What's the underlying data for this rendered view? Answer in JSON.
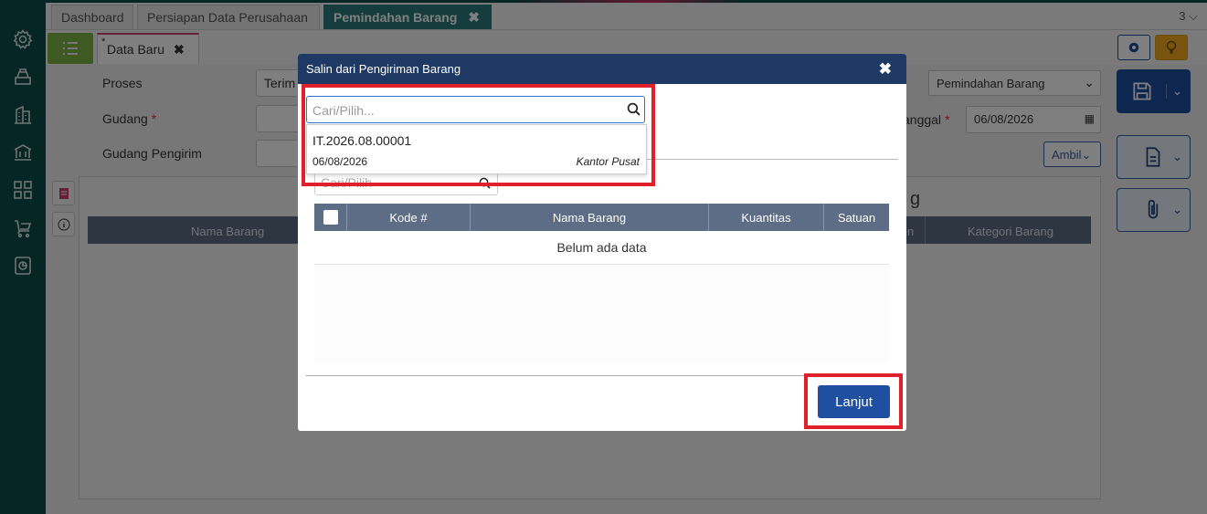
{
  "tabs": [
    {
      "label": "Dashboard"
    },
    {
      "label": "Persiapan Data Perusahaan"
    },
    {
      "label": "Pemindahan Barang",
      "close": "✖"
    }
  ],
  "tab_count": "3 ⌵",
  "doc_tab": {
    "marker": "*",
    "label": "Data Baru",
    "close": "✖"
  },
  "form": {
    "proses_label": "Proses",
    "proses_value": "Terim",
    "gudang_label": "Gudang",
    "gudang_pengirim_label": "Gudang Pengirim",
    "required_mark": "*",
    "right_select": "Pemindahan Barang",
    "tanggal_label": "anggal",
    "tanggal_value": "06/08/2026",
    "ambil_label": "Ambil"
  },
  "grid": {
    "col_nama_barang": "Nama Barang",
    "col_kategori": "Kategori Barang",
    "partial_heading": "g",
    "partial_col": "n"
  },
  "modal": {
    "title": "Salin dari Pengiriman Barang",
    "close": "✖",
    "search_placeholder": "Cari/Pilih...",
    "dropdown_item": {
      "code": "IT.2026.08.00001",
      "date": "06/08/2026",
      "location": "Kantor Pusat"
    },
    "search2_placeholder": "Cari/Pilih",
    "columns": [
      "Kode #",
      "Nama Barang",
      "Kuantitas",
      "Satuan"
    ],
    "empty_text": "Belum ada data",
    "continue_button": "Lanjut"
  },
  "colors": {
    "sidebar": "#0d4a4a",
    "active_tab": "#2a7a7c",
    "modal_header": "#1e3a64",
    "primary_button": "#1f4fa0",
    "highlight": "#e0202a"
  }
}
